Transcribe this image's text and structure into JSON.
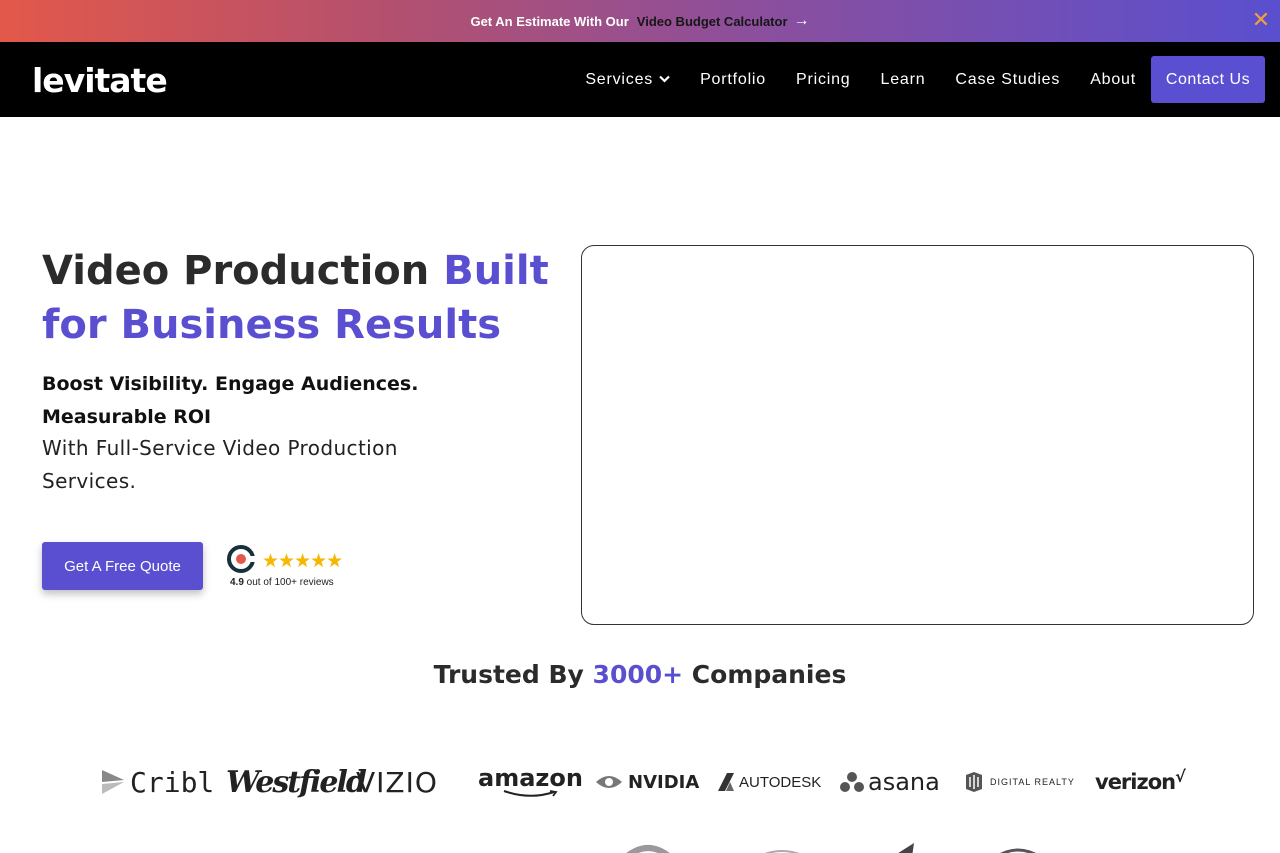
{
  "promo": {
    "text": "Get An Estimate With Our",
    "link_label": "Video Budget Calculator",
    "arrow": "→",
    "close": "✕"
  },
  "nav": {
    "logo": "levitate",
    "items": [
      {
        "label": "Services",
        "has_dropdown": true
      },
      {
        "label": "Portfolio"
      },
      {
        "label": "Pricing"
      },
      {
        "label": "Learn"
      },
      {
        "label": "Case Studies"
      },
      {
        "label": "About"
      }
    ],
    "dropdown_icon": "chevron-down-icon",
    "cta_label": "Contact Us"
  },
  "hero": {
    "title_part1": "Video Production ",
    "title_accent": "Built for Business Results",
    "subtitle_bold": "Boost Visibility. Engage Audiences. Measurable ROI",
    "subtitle_normal": "With Full-Service Video Production Services.",
    "cta_label": "Get A Free Quote",
    "rating": {
      "score": "4.9",
      "text": " out of 100+ reviews",
      "stars": "★★★★★",
      "stars_value": 5,
      "icon": "clutch-icon"
    }
  },
  "trusted": {
    "prefix": "Trusted By ",
    "count": "3000+",
    "suffix": " Companies"
  },
  "logos": {
    "cribl": "Cribl",
    "westfield": "Westfield",
    "vizio": "VIZIO",
    "amazon": "amazon",
    "nvidia": "NVIDIA",
    "autodesk": "AUTODESK",
    "asana": "asana",
    "digital_realty": "DIGITAL REALTY",
    "verizon": "verizon",
    "verizon_check": "√"
  },
  "colors": {
    "accent": "#5a4fd0",
    "nav_bg": "#000000",
    "promo_gradient_start": "#e3584a",
    "promo_gradient_end": "#5a4fcf",
    "star": "#f5b800",
    "close": "#f2a23a"
  }
}
